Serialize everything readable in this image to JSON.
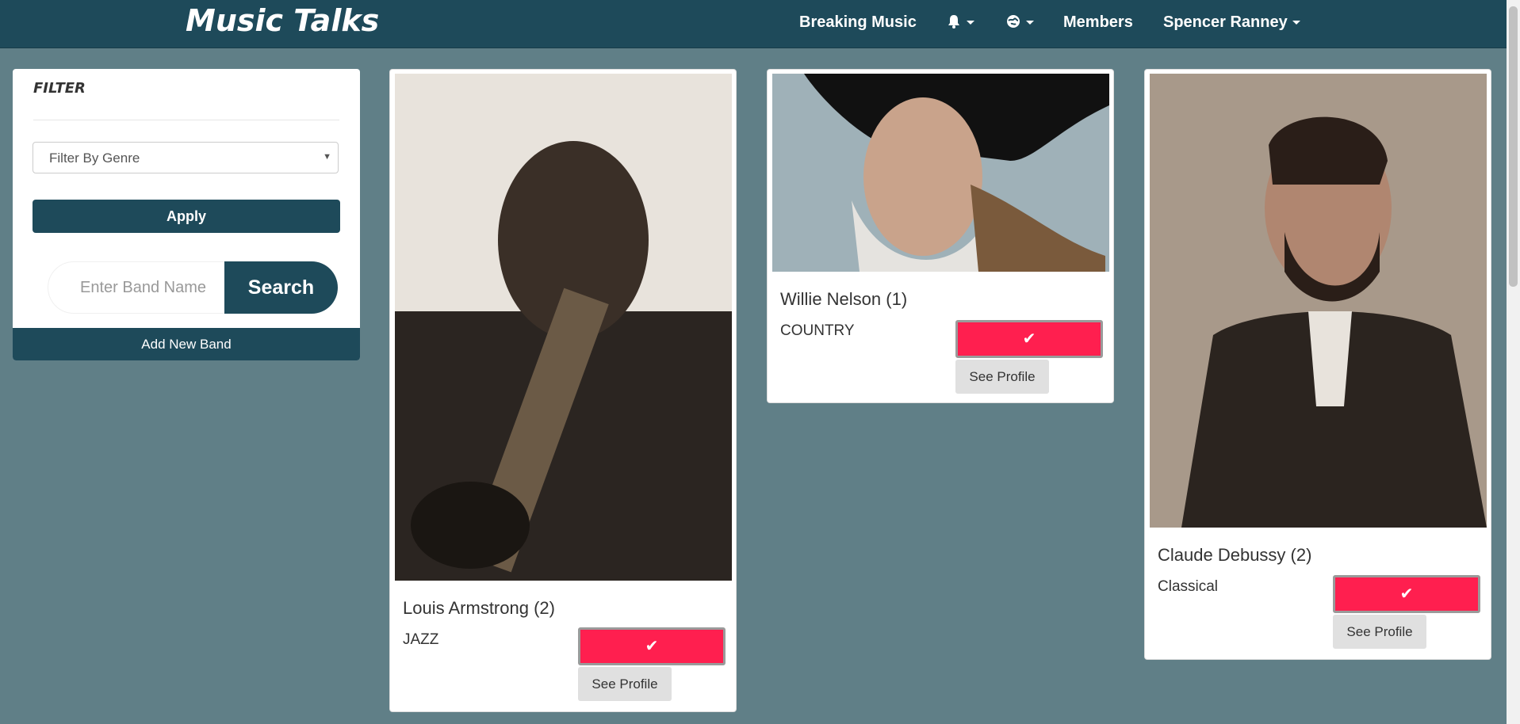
{
  "app": {
    "brand": "Music Talks"
  },
  "nav": {
    "breaking_music": "Breaking Music",
    "bell_icon": "bell-icon",
    "globe_icon": "globe-icon",
    "members": "Members",
    "user": "Spencer Ranney"
  },
  "filter": {
    "title": "FILTER",
    "genre_select": "Filter By Genre",
    "apply": "Apply",
    "search_placeholder": "Enter Band Name",
    "search_button": "Search",
    "add_band": "Add New Band"
  },
  "cards": [
    {
      "name": "Louis Armstrong (2)",
      "genre": "JAZZ",
      "profile": "See Profile"
    },
    {
      "name": "Willie Nelson (1)",
      "genre": "COUNTRY",
      "profile": "See Profile"
    },
    {
      "name": "Claude Debussy (2)",
      "genre": "Classical",
      "profile": "See Profile"
    }
  ],
  "icons": {
    "check": "check-icon"
  },
  "colors": {
    "navbar": "#1e4a5a",
    "background": "#607f87",
    "accent": "#ff1f4f"
  }
}
